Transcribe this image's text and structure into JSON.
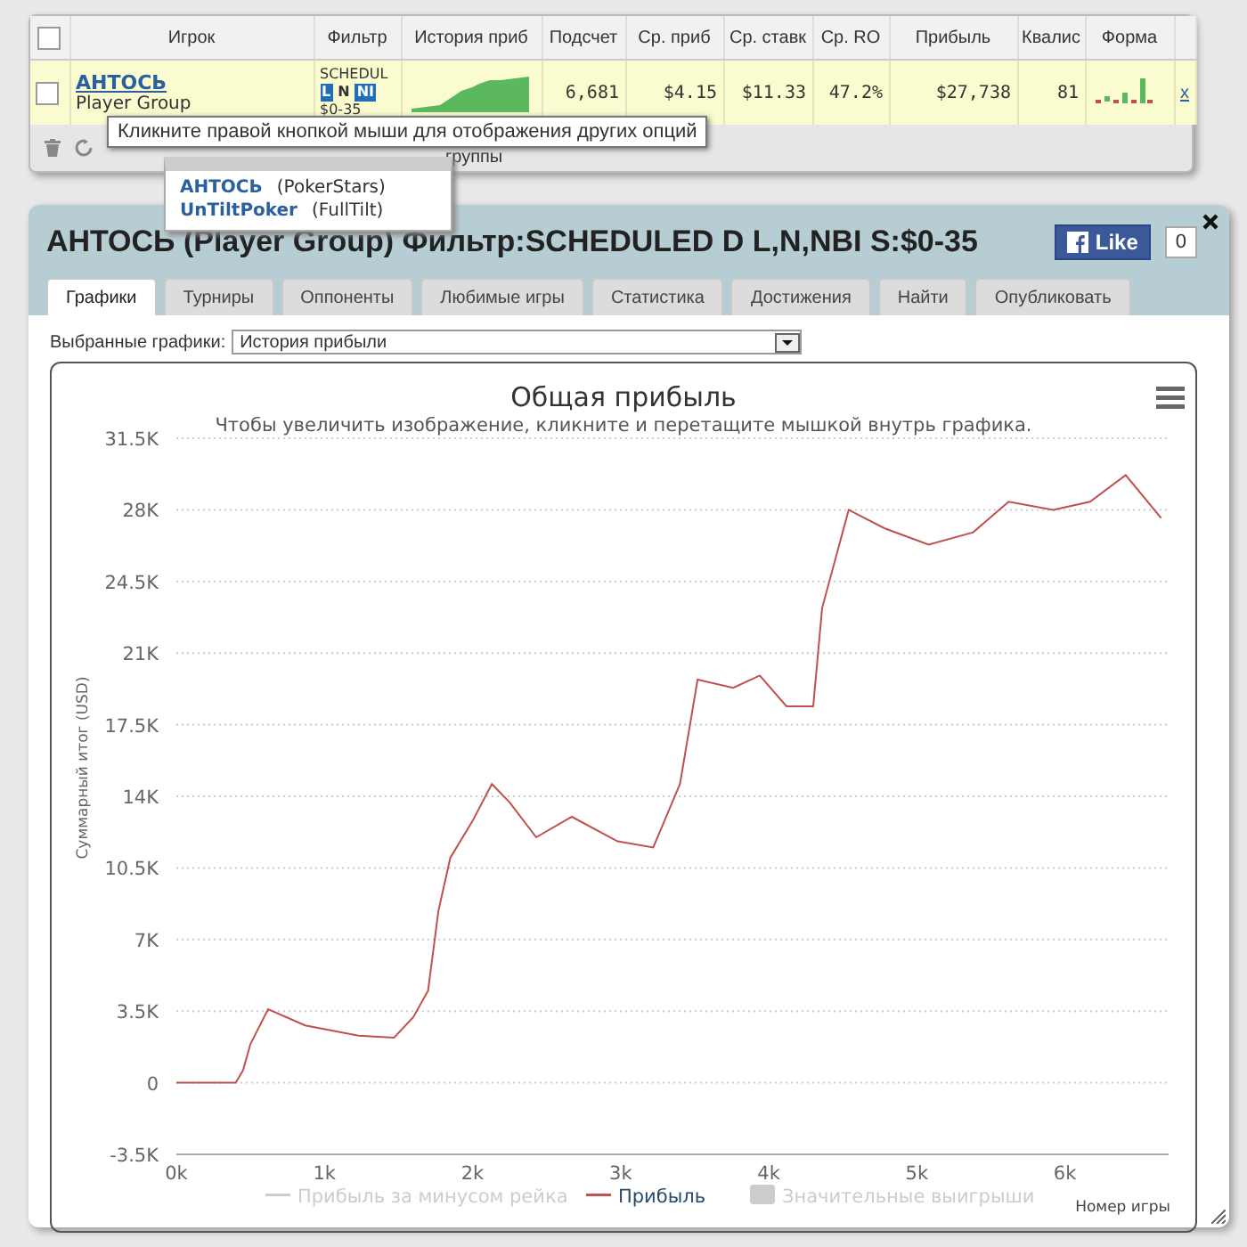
{
  "players_table": {
    "header_checked": false,
    "columns": [
      "Игрок",
      "Фильтр",
      "История приб",
      "Подсчет",
      "Ср. приб",
      "Ср. ставк",
      "Ср. RO",
      "Прибыль",
      "Квалис",
      "Форма"
    ],
    "rows": [
      {
        "checked": false,
        "player": "АНТОСЬ",
        "group": "Player Group",
        "filter": {
          "text": "SCHEDUL",
          "tags": [
            {
              "text": "L",
              "kind": "badge"
            },
            {
              "text": "N",
              "kind": "plain"
            },
            {
              "text": "NI",
              "kind": "badge"
            }
          ],
          "stake": "$0-35"
        },
        "count": "6,681",
        "avg_profit": "$4.15",
        "avg_stake": "$11.33",
        "avg_roi": "47.2%",
        "profit": "$27,738",
        "qualif": "81",
        "remove": "x"
      }
    ],
    "footer_text": "группы"
  },
  "tooltip": "Кликните правой кнопкой мыши для отображения других опций",
  "accounts_popup": [
    {
      "name": "АНТОСЬ",
      "site": "(PokerStars)"
    },
    {
      "name": "UnTiltPoker",
      "site": "(FullTilt)"
    }
  ],
  "panel": {
    "title": "АНТОСЬ (Player Group) Фильтр:SCHEDULED D L,N,NBI S:$0-35",
    "like": {
      "label": "Like",
      "count": "0"
    },
    "tabs": [
      {
        "label": "Графики",
        "selected": true
      },
      {
        "label": "Турниры",
        "selected": false
      },
      {
        "label": "Оппоненты",
        "selected": false
      },
      {
        "label": "Любимые игры",
        "selected": false
      },
      {
        "label": "Статистика",
        "selected": false
      },
      {
        "label": "Достижения",
        "selected": false
      },
      {
        "label": "Найти",
        "selected": false
      },
      {
        "label": "Опубликовать",
        "selected": false
      }
    ],
    "chart_select": {
      "label": "Выбранные графики:",
      "value": "История прибыли"
    },
    "chart": {
      "legend": [
        {
          "label": "Прибыль за минусом рейка",
          "kind": "line",
          "selected": false
        },
        {
          "kind": "series",
          "selected": true
        },
        {
          "label": "Значительные выигрыши",
          "kind": "area",
          "selected": false
        }
      ],
      "chart_data": {
        "type": "line",
        "title": "Общая прибыль",
        "subtitle": "Чтобы увеличить изображение, кликните и перетащите мышкой внутрь графика.",
        "xlabel": "Номер игры",
        "ylabel": "Суммарный итог (USD)",
        "x": [
          0,
          400,
          450,
          500,
          620,
          870,
          1230,
          1470,
          1600,
          1700,
          1770,
          1850,
          2000,
          2130,
          2250,
          2430,
          2670,
          2980,
          3220,
          3400,
          3520,
          3760,
          3940,
          4120,
          4300,
          4360,
          4540,
          4780,
          5080,
          5380,
          5620,
          5920,
          6170,
          6410,
          6650
        ],
        "series": [
          {
            "name": "Прибыль",
            "color": "#c0504d",
            "values": [
              0,
              0,
              600,
              1900,
              3600,
              2800,
              2300,
              2200,
              3200,
              4500,
              8400,
              11000,
              12800,
              14600,
              13700,
              12000,
              13000,
              11800,
              11500,
              14600,
              19700,
              19300,
              19900,
              18400,
              18400,
              23200,
              28000,
              27100,
              26300,
              26900,
              28400,
              28000,
              28400,
              29700,
              27600
            ]
          }
        ],
        "grid": true,
        "xlim": [
          0,
          6700
        ],
        "ylim": [
          -3500,
          31500
        ],
        "xticks": [
          {
            "value": 0,
            "label": "0k"
          },
          {
            "value": 1000,
            "label": "1k"
          },
          {
            "value": 2000,
            "label": "2k"
          },
          {
            "value": 3000,
            "label": "3k"
          },
          {
            "value": 4000,
            "label": "4k"
          },
          {
            "value": 5000,
            "label": "5k"
          },
          {
            "value": 6000,
            "label": "6k"
          }
        ],
        "yticks": [
          {
            "value": -3500,
            "label": "-3.5K"
          },
          {
            "value": 0,
            "label": "0"
          },
          {
            "value": 3500,
            "label": "3.5K"
          },
          {
            "value": 7000,
            "label": "7K"
          },
          {
            "value": 10500,
            "label": "10.5K"
          },
          {
            "value": 14000,
            "label": "14K"
          },
          {
            "value": 17500,
            "label": "17.5K"
          },
          {
            "value": 21000,
            "label": "21K"
          },
          {
            "value": 24500,
            "label": "24.5K"
          },
          {
            "value": 28000,
            "label": "28K"
          },
          {
            "value": 31500,
            "label": "31.5K"
          }
        ]
      }
    }
  }
}
